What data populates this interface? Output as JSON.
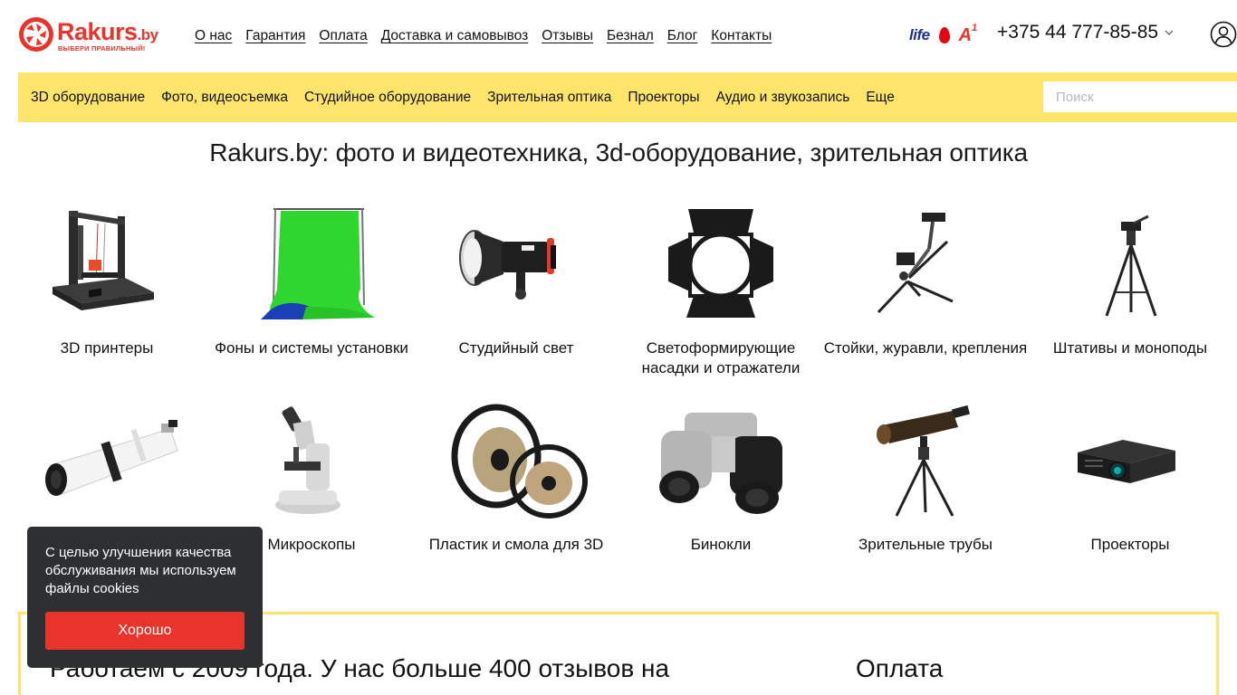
{
  "header": {
    "logo": {
      "name": "Rakurs",
      "suffix": ".by",
      "slogan": "ВЫБЕРИ ПРАВИЛЬНЫЙ!"
    },
    "nav": [
      "О нас",
      "Гарантия",
      "Оплата",
      "Доставка и самовывоз",
      "Отзывы",
      "Безнал",
      "Блог",
      "Контакты"
    ],
    "operators": {
      "life": "life",
      "a1": "A",
      "a1_sup": "1"
    },
    "phone": "+375 44 777-85-85"
  },
  "categories_bar": {
    "items": [
      "3D оборудование",
      "Фото, видеосъемка",
      "Студийное оборудование",
      "Зрительная оптика",
      "Проекторы",
      "Аудио и звукозапись",
      "Еще"
    ],
    "search_placeholder": "Поиск"
  },
  "page_title": "Rakurs.by: фото и видеотехника, 3d-оборудование, зрительная оптика",
  "grid": {
    "row1": [
      {
        "label": "3D принтеры",
        "icon": "3d-printer"
      },
      {
        "label": "Фоны и системы установки",
        "icon": "green-backdrop"
      },
      {
        "label": "Студийный свет",
        "icon": "studio-flash"
      },
      {
        "label": "Светоформирующие насадки и отражатели",
        "icon": "barn-doors"
      },
      {
        "label": "Стойки, журавли, крепления",
        "icon": "magic-arm-stand"
      },
      {
        "label": "Штативы и моноподы",
        "icon": "tripod"
      }
    ],
    "row2": [
      {
        "label": "",
        "icon": "telescope"
      },
      {
        "label": "Микроскопы",
        "icon": "microscope"
      },
      {
        "label": "Пластик и смола для 3D",
        "icon": "filament-spools"
      },
      {
        "label": "Бинокли",
        "icon": "binoculars"
      },
      {
        "label": "Зрительные трубы",
        "icon": "spotting-scope"
      },
      {
        "label": "Проекторы",
        "icon": "projector"
      }
    ]
  },
  "info": {
    "about": "Работаем с 2009 года. У нас больше 400 отзывов на",
    "payment": "Оплата"
  },
  "cookie": {
    "text": "С целью улучшения качества обслуживания мы используем файлы cookies",
    "button": "Хорошо"
  },
  "colors": {
    "brand_red": "#e8342a",
    "accent_yellow": "#fde56c",
    "popup_bg": "#2e2f33"
  }
}
